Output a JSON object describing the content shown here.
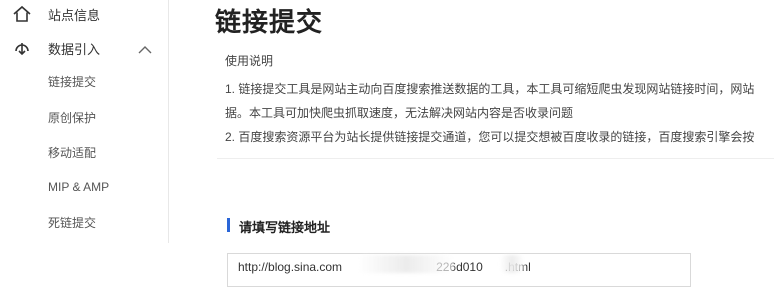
{
  "sidebar": {
    "site_info": {
      "label": "站点信息",
      "icon": "home-icon"
    },
    "data_import": {
      "label": "数据引入",
      "icon": "data-import-icon",
      "expanded": true
    },
    "items": [
      {
        "label": "链接提交",
        "active": true
      },
      {
        "label": "原创保护"
      },
      {
        "label": "移动适配"
      },
      {
        "label": "MIP & AMP"
      },
      {
        "label": "死链提交"
      }
    ]
  },
  "main": {
    "title": "链接提交",
    "usage_title": "使用说明",
    "usage_lines": [
      "1. 链接提交工具是网站主动向百度搜索推送数据的工具，本工具可缩短爬虫发现网站链接时间，网站",
      "据。本工具可加快爬虫抓取速度，无法解决网站内容是否收录问题",
      "2. 百度搜索资源平台为站长提供链接提交通道，您可以提交想被百度收录的链接，百度搜索引擎会按"
    ],
    "section_title": "请填写链接地址",
    "url_input": {
      "value_prefix": "http://blog.sina.com",
      "value_middle": "226d010",
      "value_suffix": ".html"
    }
  },
  "colors": {
    "accent": "#2a66d8",
    "sidebar_border": "#e8e8e8"
  }
}
